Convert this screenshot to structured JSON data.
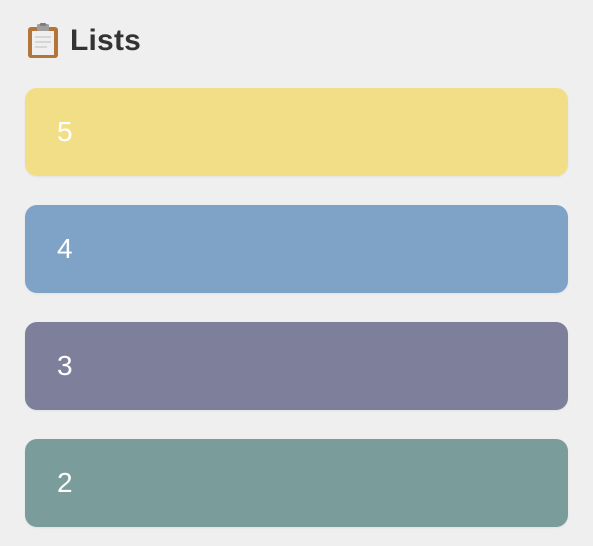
{
  "header": {
    "title": "Lists",
    "icon": "clipboard-icon"
  },
  "lists": [
    {
      "label": "5",
      "color": "#f2de86"
    },
    {
      "label": "4",
      "color": "#7fa3c6"
    },
    {
      "label": "3",
      "color": "#7e7f9b"
    },
    {
      "label": "2",
      "color": "#7a9d9c"
    }
  ]
}
